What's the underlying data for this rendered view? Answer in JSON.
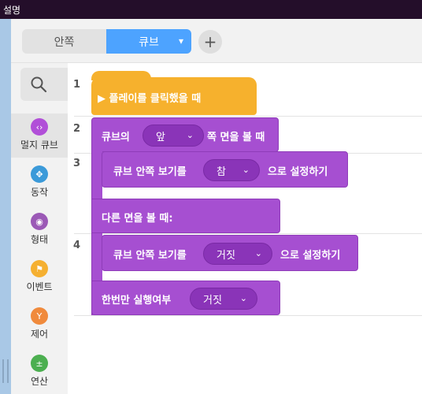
{
  "titlebar": {
    "title": "설명"
  },
  "tabs": {
    "inside": "안쪽",
    "cube": "큐브",
    "cube_chevron": "▾",
    "add": "+"
  },
  "sidebar": {
    "search_icon": "search-icon",
    "categories": [
      {
        "label": "멀지 큐브",
        "icon": "remote-cube-icon",
        "color": "#b14fd8",
        "glyph": "‹›"
      },
      {
        "label": "동작",
        "icon": "move-icon",
        "color": "#3b9ad9",
        "glyph": "✥"
      },
      {
        "label": "형태",
        "icon": "eye-icon",
        "color": "#9b59b6",
        "glyph": "◉"
      },
      {
        "label": "이벤트",
        "icon": "flag-icon",
        "color": "#f5b031",
        "glyph": "⚑"
      },
      {
        "label": "제어",
        "icon": "control-icon",
        "color": "#f08a3c",
        "glyph": "Y"
      },
      {
        "label": "연산",
        "icon": "operator-icon",
        "color": "#4caf50",
        "glyph": "±"
      }
    ]
  },
  "script": {
    "line_numbers": [
      "1",
      "2",
      "3",
      "4"
    ],
    "when_play": "▶ 플레이를 클릭했을 때",
    "face_prefix": "큐브의",
    "face_value": "앞",
    "face_suffix": "쪽 면을 볼 때",
    "set1_prefix": "큐브 안쪽 보기를",
    "set1_value": "참",
    "set1_suffix": "으로 설정하기",
    "else_label": "다른 면을 볼 때:",
    "set2_prefix": "큐브 안쪽 보기를",
    "set2_value": "거짓",
    "set2_suffix": "으로 설정하기",
    "once_prefix": "한번만 실행여부",
    "once_value": "거짓",
    "chevron": "⌄"
  }
}
